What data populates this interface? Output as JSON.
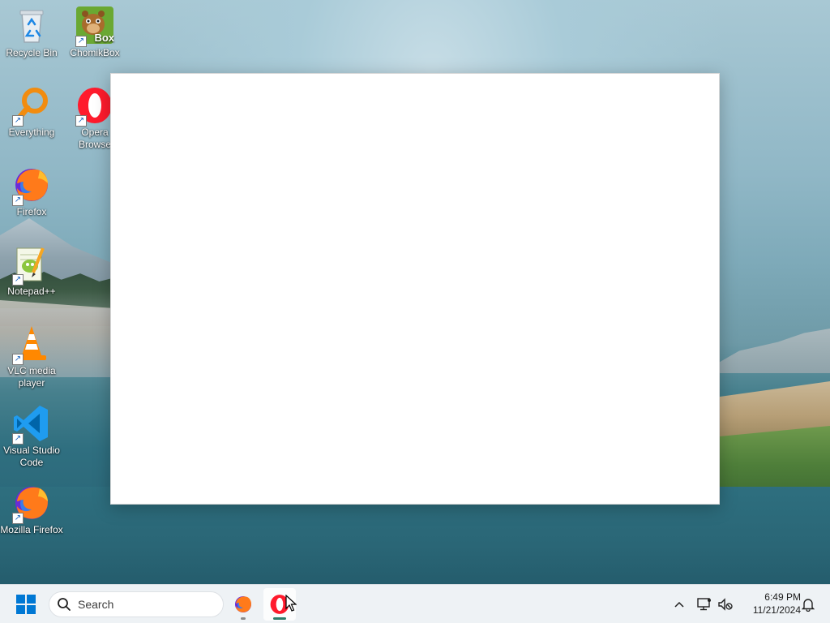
{
  "desktop": {
    "icons": [
      {
        "label": "Recycle Bin",
        "icon": "recycle-bin-icon"
      },
      {
        "label": "ChomikBox",
        "icon": "chomikbox-icon",
        "badge": "Box"
      },
      {
        "label": "Everything",
        "icon": "everything-search-icon"
      },
      {
        "label": "Opera Browser",
        "icon": "opera-icon",
        "label_visible": "Opera\nBrowse"
      },
      {
        "label": "Firefox",
        "icon": "firefox-icon"
      },
      {
        "label": "Notepad++",
        "icon": "notepad-plus-plus-icon"
      },
      {
        "label": "VLC media player",
        "icon": "vlc-icon"
      },
      {
        "label": "Visual Studio Code",
        "icon": "vscode-icon"
      },
      {
        "label": "Mozilla Firefox",
        "icon": "firefox-icon"
      }
    ],
    "opera_label_line1": "Opera",
    "opera_label_line2": "Browse"
  },
  "window": {
    "state": "blank"
  },
  "taskbar": {
    "search_placeholder": "Search",
    "pinned": [
      {
        "name": "Firefox",
        "icon": "firefox-icon",
        "running": true,
        "active": false
      },
      {
        "name": "Opera",
        "icon": "opera-icon",
        "running": true,
        "active": true
      }
    ],
    "clock": {
      "time": "6:49 PM",
      "date": "11/21/2024"
    },
    "colors": {
      "taskbar_bg": "#eef2f5",
      "running_indicator": "#2e7d6b",
      "start_blue": "#0078d4"
    }
  }
}
